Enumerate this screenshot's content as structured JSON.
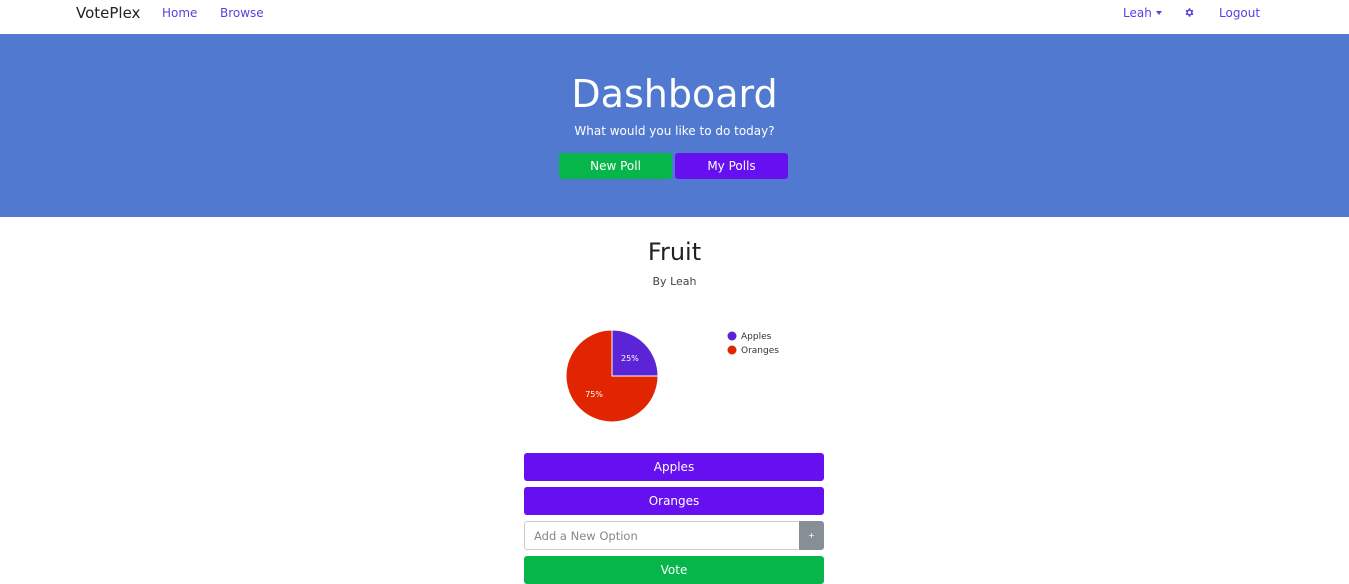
{
  "navbar": {
    "brand": "VotePlex",
    "home": "Home",
    "browse": "Browse",
    "user": "Leah",
    "settings_icon": "gear-icon",
    "logout": "Logout"
  },
  "hero": {
    "title": "Dashboard",
    "subtitle": "What would you like to do today?",
    "new_poll": "New Poll",
    "my_polls": "My Polls",
    "bg_color": "#5179cf"
  },
  "poll": {
    "title": "Fruit",
    "author": "By Leah",
    "options": [
      "Apples",
      "Oranges"
    ],
    "add_placeholder": "Add a New Option",
    "add_button": "+",
    "vote": "Vote"
  },
  "chart_data": {
    "type": "pie",
    "categories": [
      "Apples",
      "Oranges"
    ],
    "values": [
      25,
      75
    ],
    "labels": [
      "25%",
      "75%"
    ],
    "colors": [
      "#5b24d6",
      "#e02500"
    ],
    "legend": "right"
  },
  "colors": {
    "accent": "#6610f2",
    "success": "#06b64a",
    "link": "#5a3fe0"
  }
}
